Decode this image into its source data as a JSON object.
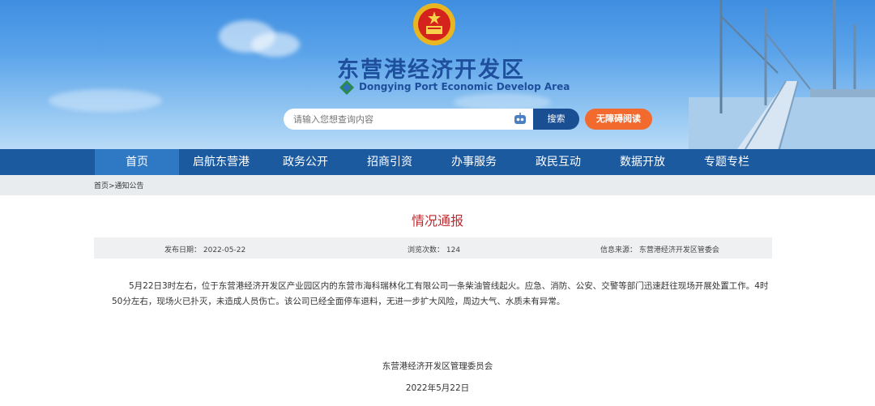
{
  "header": {
    "title": "东营港经济开发区",
    "subtitle": "Dongying Port Economic Develop Area",
    "search_placeholder": "请输入您想查询内容",
    "search_button": "搜索",
    "accessibility_button": "无障碍阅读"
  },
  "nav": {
    "items": [
      {
        "label": "首页",
        "active": true
      },
      {
        "label": "启航东营港"
      },
      {
        "label": "政务公开"
      },
      {
        "label": "招商引资"
      },
      {
        "label": "办事服务"
      },
      {
        "label": "政民互动"
      },
      {
        "label": "数据开放"
      },
      {
        "label": "专题专栏"
      }
    ]
  },
  "breadcrumb": "首页>通知公告",
  "article": {
    "title": "情况通报",
    "publish_date": "发布日期：  2022-05-22",
    "views": "浏览次数：  124",
    "source": "信息来源：  东营港经济开发区管委会",
    "body": "5月22日3时左右，位于东营港经济开发区产业园区内的东营市海科瑞林化工有限公司一条柴油管线起火。应急、消防、公安、交警等部门迅速赶往现场开展处置工作。4时50分左右，现场火已扑灭，未造成人员伤亡。该公司已经全面停车退料，无进一步扩大风险，周边大气、水质未有异常。",
    "signature": "东营港经济开发区管理委员会",
    "date": "2022年5月22日"
  },
  "colors": {
    "nav_bg": "#1c5a9f",
    "nav_active": "#2f78c4",
    "title_red": "#c0282e",
    "accent_orange": "#f26a2e"
  }
}
